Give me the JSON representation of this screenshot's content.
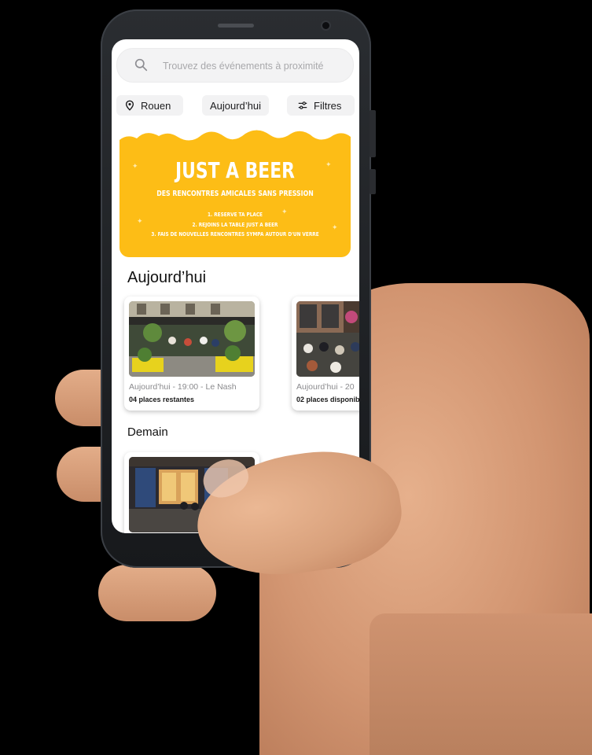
{
  "search": {
    "placeholder": "Trouvez des événements à proximité"
  },
  "filters": {
    "location": "Rouen",
    "date": "Aujourd’hui",
    "more": "Filtres"
  },
  "banner": {
    "title": "JUST A BEER",
    "subtitle": "DES RENCONTRES AMICALES SANS PRESSION",
    "steps": [
      "1. RESERVE TA PLACE",
      "2. REJOINS LA TABLE JUST A BEER",
      "3. FAIS DE NOUVELLES RENCONTRES SYMPA AUTOUR D'UN VERRE"
    ]
  },
  "sections": {
    "today": "Aujourd’hui",
    "tomorrow": "Demain"
  },
  "events_today": [
    {
      "meta": "Aujourd’hui - 19:00 - Le Nash",
      "places": "04 places restantes"
    },
    {
      "meta": "Aujourd’hui - 20",
      "places": "02 places disponib"
    }
  ],
  "colors": {
    "accent": "#fdbd16",
    "screen_bg": "#ffffff",
    "chip_bg": "#f2f2f3"
  },
  "icons": {
    "search": "search-icon",
    "location": "location-pin-icon",
    "filters": "sliders-icon"
  }
}
